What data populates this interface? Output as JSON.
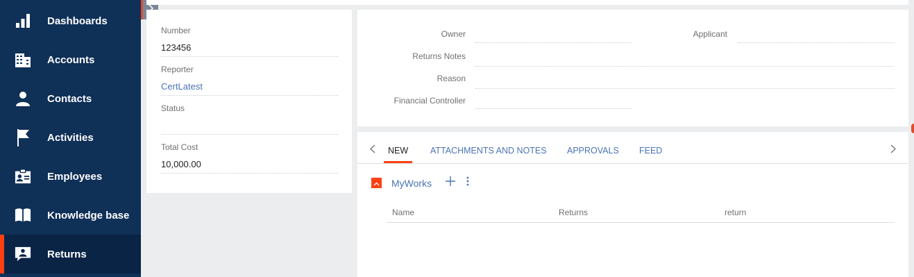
{
  "sidebar": {
    "items": [
      {
        "label": "Dashboards",
        "icon": "bar-chart-icon"
      },
      {
        "label": "Accounts",
        "icon": "building-icon"
      },
      {
        "label": "Contacts",
        "icon": "person-icon"
      },
      {
        "label": "Activities",
        "icon": "flag-icon"
      },
      {
        "label": "Employees",
        "icon": "id-card-icon"
      },
      {
        "label": "Knowledge base",
        "icon": "book-icon"
      },
      {
        "label": "Returns",
        "icon": "chat-person-icon"
      }
    ],
    "active": "Returns"
  },
  "left_fields": {
    "number_label": "Number",
    "number_value": "123456",
    "reporter_label": "Reporter",
    "reporter_value": "CertLatest",
    "status_label": "Status",
    "status_value": "",
    "total_cost_label": "Total Cost",
    "total_cost_value": "10,000.00"
  },
  "right_fields": {
    "owner_label": "Owner",
    "applicant_label": "Applicant",
    "returns_notes_label": "Returns Notes",
    "reason_label": "Reason",
    "financial_controller_label": "Financial Controller"
  },
  "tabs": {
    "items": [
      "NEW",
      "ATTACHMENTS AND NOTES",
      "APPROVALS",
      "FEED"
    ],
    "active": "NEW"
  },
  "detail": {
    "title": "MyWorks",
    "columns": [
      "Name",
      "Returns",
      "return"
    ]
  },
  "colors": {
    "sidebar_bg": "#0f3057",
    "accent": "#ff4013",
    "link": "#4a74b3"
  }
}
